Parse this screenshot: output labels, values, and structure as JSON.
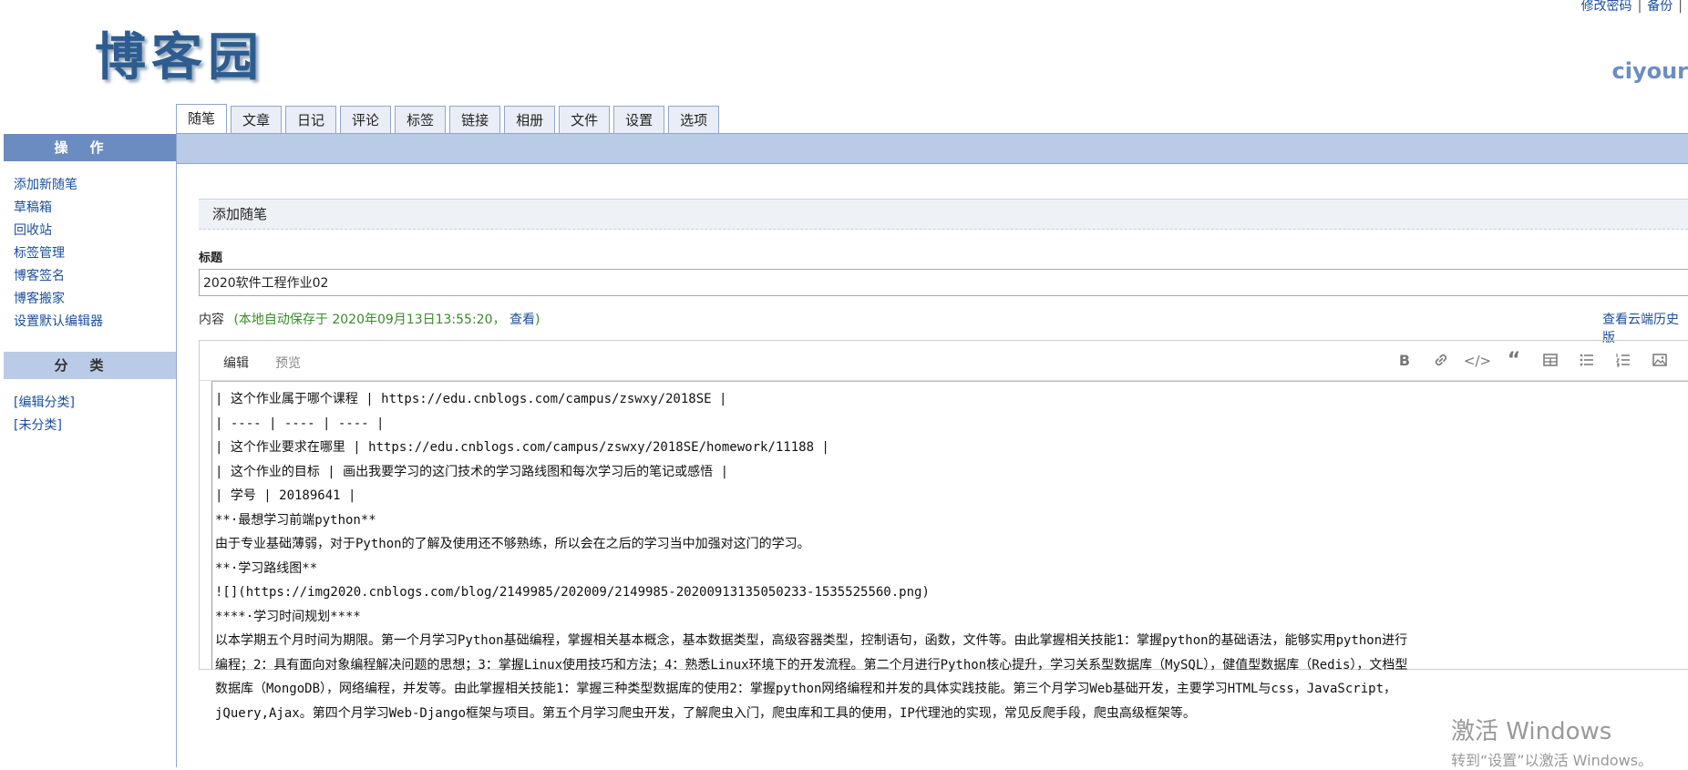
{
  "header": {
    "logo_text": "博客园",
    "top_links": [
      "修改密码",
      "备份"
    ],
    "username": "ciyour"
  },
  "tabs": [
    "随笔",
    "文章",
    "日记",
    "评论",
    "标签",
    "链接",
    "相册",
    "文件",
    "设置",
    "选项"
  ],
  "sidebar": {
    "ops_title": "操作",
    "ops_items": [
      "添加新随笔",
      "草稿箱",
      "回收站",
      "标签管理",
      "博客签名",
      "博客搬家",
      "设置默认编辑器"
    ],
    "cat_title": "分类",
    "cat_items": [
      "[编辑分类]",
      "[未分类]"
    ]
  },
  "main": {
    "section_title": "添加随笔",
    "title_label": "标题",
    "title_value": "2020软件工程作业02",
    "content_label": "内容",
    "autosave_text": "(本地自动保存于 2020年09月13日13:55:20，",
    "autosave_view": "查看",
    "autosave_close": ")",
    "history_link": "查看云端历史版"
  },
  "editor": {
    "tab_edit": "编辑",
    "tab_preview": "预览",
    "toolbar_icons": [
      "bold-icon",
      "link-icon",
      "code-icon",
      "quote-icon",
      "table-icon",
      "bullet-list-icon",
      "numbered-list-icon",
      "image-icon",
      "fullscreen-icon"
    ],
    "lines": [
      "|   这个作业属于哪个课程 | https://edu.cnblogs.com/campus/zswxy/2018SE     |",
      "| ---- | ---- | ---- |",
      "|   这个作业要求在哪里   |  https://edu.cnblogs.com/campus/zswxy/2018SE/homework/11188    |",
      "| 这个作业的目标 | 画出我要学习的这门技术的学习路线图和每次学习后的笔记或感悟 |",
      "| 学号 | 20189641 |",
      "**·最想学习前端python**",
      "由于专业基础薄弱，对于Python的了解及使用还不够熟练，所以会在之后的学习当中加强对这门的学习。",
      "**·学习路线图**",
      "![](https://img2020.cnblogs.com/blog/2149985/202009/2149985-20200913135050233-1535525560.png)",
      "****·学习时间规划****",
      "以本学期五个月时间为期限。第一个月学习Python基础编程，掌握相关基本概念，基本数据类型，高级容器类型，控制语句，函数，文件等。由此掌握相关技能1：掌握python的基础语法，能够实用python进行",
      "编程；2：具有面向对象编程解决问题的思想；3：掌握Linux使用技巧和方法；4：熟悉Linux环境下的开发流程。第二个月进行Python核心提升，学习关系型数据库（MySQL），健值型数据库（Redis），文档型",
      "数据库（MongoDB），网络编程，并发等。由此掌握相关技能1：掌握三种类型数据库的使用2：掌握python网络编程和并发的具体实践技能。第三个月学习Web基础开发，主要学习HTML与css，JavaScript，",
      "jQuery,Ajax。第四个月学习Web-Django框架与项目。第五个月学习爬虫开发，了解爬虫入门，爬虫库和工具的使用，IP代理池的实现，常见反爬手段，爬虫高级框架等。"
    ]
  },
  "watermark": {
    "line1": "激活 Windows",
    "line2": "转到“设置”以激活 Windows。"
  }
}
